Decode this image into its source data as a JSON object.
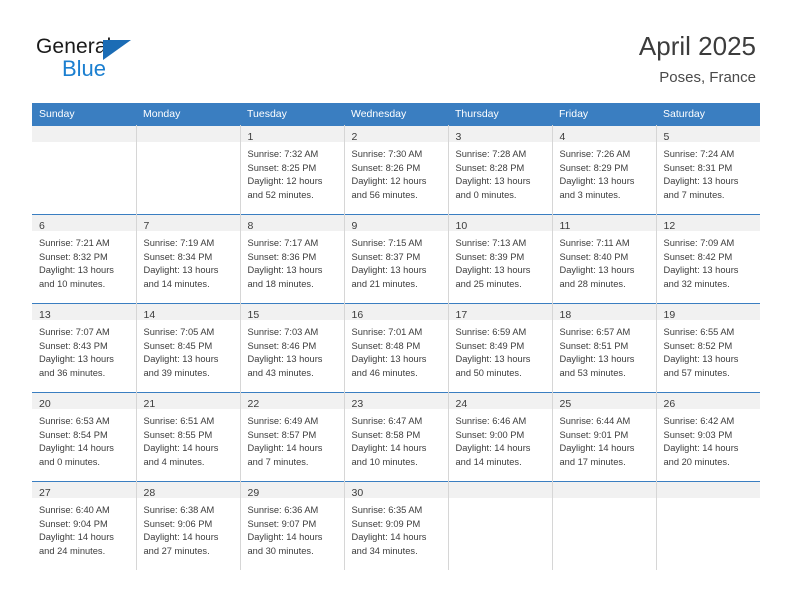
{
  "brand": {
    "name_top": "General",
    "name_bottom": "Blue",
    "triangle_icon": "blue-triangle-icon",
    "color_primary": "#1b7fd0",
    "color_text": "#1a1a1a"
  },
  "header": {
    "title": "April 2025",
    "subtitle": "Poses, France"
  },
  "theme": {
    "header_bg": "#3a7ec1",
    "header_text": "#ffffff",
    "daynum_strip_bg": "#f1f1f1",
    "cell_text": "#3c3c3c",
    "row_divider": "#3a7ec1",
    "col_divider": "#d6d6d6"
  },
  "weekday_headers": [
    "Sunday",
    "Monday",
    "Tuesday",
    "Wednesday",
    "Thursday",
    "Friday",
    "Saturday"
  ],
  "labels": {
    "sunrise_prefix": "Sunrise:",
    "sunset_prefix": "Sunset:",
    "daylight_prefix": "Daylight:"
  },
  "weeks": [
    [
      {
        "day": "",
        "lines": []
      },
      {
        "day": "",
        "lines": []
      },
      {
        "day": "1",
        "lines": [
          "Sunrise: 7:32 AM",
          "Sunset: 8:25 PM",
          "Daylight: 12 hours",
          "and 52 minutes."
        ]
      },
      {
        "day": "2",
        "lines": [
          "Sunrise: 7:30 AM",
          "Sunset: 8:26 PM",
          "Daylight: 12 hours",
          "and 56 minutes."
        ]
      },
      {
        "day": "3",
        "lines": [
          "Sunrise: 7:28 AM",
          "Sunset: 8:28 PM",
          "Daylight: 13 hours",
          "and 0 minutes."
        ]
      },
      {
        "day": "4",
        "lines": [
          "Sunrise: 7:26 AM",
          "Sunset: 8:29 PM",
          "Daylight: 13 hours",
          "and 3 minutes."
        ]
      },
      {
        "day": "5",
        "lines": [
          "Sunrise: 7:24 AM",
          "Sunset: 8:31 PM",
          "Daylight: 13 hours",
          "and 7 minutes."
        ]
      }
    ],
    [
      {
        "day": "6",
        "lines": [
          "Sunrise: 7:21 AM",
          "Sunset: 8:32 PM",
          "Daylight: 13 hours",
          "and 10 minutes."
        ]
      },
      {
        "day": "7",
        "lines": [
          "Sunrise: 7:19 AM",
          "Sunset: 8:34 PM",
          "Daylight: 13 hours",
          "and 14 minutes."
        ]
      },
      {
        "day": "8",
        "lines": [
          "Sunrise: 7:17 AM",
          "Sunset: 8:36 PM",
          "Daylight: 13 hours",
          "and 18 minutes."
        ]
      },
      {
        "day": "9",
        "lines": [
          "Sunrise: 7:15 AM",
          "Sunset: 8:37 PM",
          "Daylight: 13 hours",
          "and 21 minutes."
        ]
      },
      {
        "day": "10",
        "lines": [
          "Sunrise: 7:13 AM",
          "Sunset: 8:39 PM",
          "Daylight: 13 hours",
          "and 25 minutes."
        ]
      },
      {
        "day": "11",
        "lines": [
          "Sunrise: 7:11 AM",
          "Sunset: 8:40 PM",
          "Daylight: 13 hours",
          "and 28 minutes."
        ]
      },
      {
        "day": "12",
        "lines": [
          "Sunrise: 7:09 AM",
          "Sunset: 8:42 PM",
          "Daylight: 13 hours",
          "and 32 minutes."
        ]
      }
    ],
    [
      {
        "day": "13",
        "lines": [
          "Sunrise: 7:07 AM",
          "Sunset: 8:43 PM",
          "Daylight: 13 hours",
          "and 36 minutes."
        ]
      },
      {
        "day": "14",
        "lines": [
          "Sunrise: 7:05 AM",
          "Sunset: 8:45 PM",
          "Daylight: 13 hours",
          "and 39 minutes."
        ]
      },
      {
        "day": "15",
        "lines": [
          "Sunrise: 7:03 AM",
          "Sunset: 8:46 PM",
          "Daylight: 13 hours",
          "and 43 minutes."
        ]
      },
      {
        "day": "16",
        "lines": [
          "Sunrise: 7:01 AM",
          "Sunset: 8:48 PM",
          "Daylight: 13 hours",
          "and 46 minutes."
        ]
      },
      {
        "day": "17",
        "lines": [
          "Sunrise: 6:59 AM",
          "Sunset: 8:49 PM",
          "Daylight: 13 hours",
          "and 50 minutes."
        ]
      },
      {
        "day": "18",
        "lines": [
          "Sunrise: 6:57 AM",
          "Sunset: 8:51 PM",
          "Daylight: 13 hours",
          "and 53 minutes."
        ]
      },
      {
        "day": "19",
        "lines": [
          "Sunrise: 6:55 AM",
          "Sunset: 8:52 PM",
          "Daylight: 13 hours",
          "and 57 minutes."
        ]
      }
    ],
    [
      {
        "day": "20",
        "lines": [
          "Sunrise: 6:53 AM",
          "Sunset: 8:54 PM",
          "Daylight: 14 hours",
          "and 0 minutes."
        ]
      },
      {
        "day": "21",
        "lines": [
          "Sunrise: 6:51 AM",
          "Sunset: 8:55 PM",
          "Daylight: 14 hours",
          "and 4 minutes."
        ]
      },
      {
        "day": "22",
        "lines": [
          "Sunrise: 6:49 AM",
          "Sunset: 8:57 PM",
          "Daylight: 14 hours",
          "and 7 minutes."
        ]
      },
      {
        "day": "23",
        "lines": [
          "Sunrise: 6:47 AM",
          "Sunset: 8:58 PM",
          "Daylight: 14 hours",
          "and 10 minutes."
        ]
      },
      {
        "day": "24",
        "lines": [
          "Sunrise: 6:46 AM",
          "Sunset: 9:00 PM",
          "Daylight: 14 hours",
          "and 14 minutes."
        ]
      },
      {
        "day": "25",
        "lines": [
          "Sunrise: 6:44 AM",
          "Sunset: 9:01 PM",
          "Daylight: 14 hours",
          "and 17 minutes."
        ]
      },
      {
        "day": "26",
        "lines": [
          "Sunrise: 6:42 AM",
          "Sunset: 9:03 PM",
          "Daylight: 14 hours",
          "and 20 minutes."
        ]
      }
    ],
    [
      {
        "day": "27",
        "lines": [
          "Sunrise: 6:40 AM",
          "Sunset: 9:04 PM",
          "Daylight: 14 hours",
          "and 24 minutes."
        ]
      },
      {
        "day": "28",
        "lines": [
          "Sunrise: 6:38 AM",
          "Sunset: 9:06 PM",
          "Daylight: 14 hours",
          "and 27 minutes."
        ]
      },
      {
        "day": "29",
        "lines": [
          "Sunrise: 6:36 AM",
          "Sunset: 9:07 PM",
          "Daylight: 14 hours",
          "and 30 minutes."
        ]
      },
      {
        "day": "30",
        "lines": [
          "Sunrise: 6:35 AM",
          "Sunset: 9:09 PM",
          "Daylight: 14 hours",
          "and 34 minutes."
        ]
      },
      {
        "day": "",
        "lines": []
      },
      {
        "day": "",
        "lines": []
      },
      {
        "day": "",
        "lines": []
      }
    ]
  ]
}
